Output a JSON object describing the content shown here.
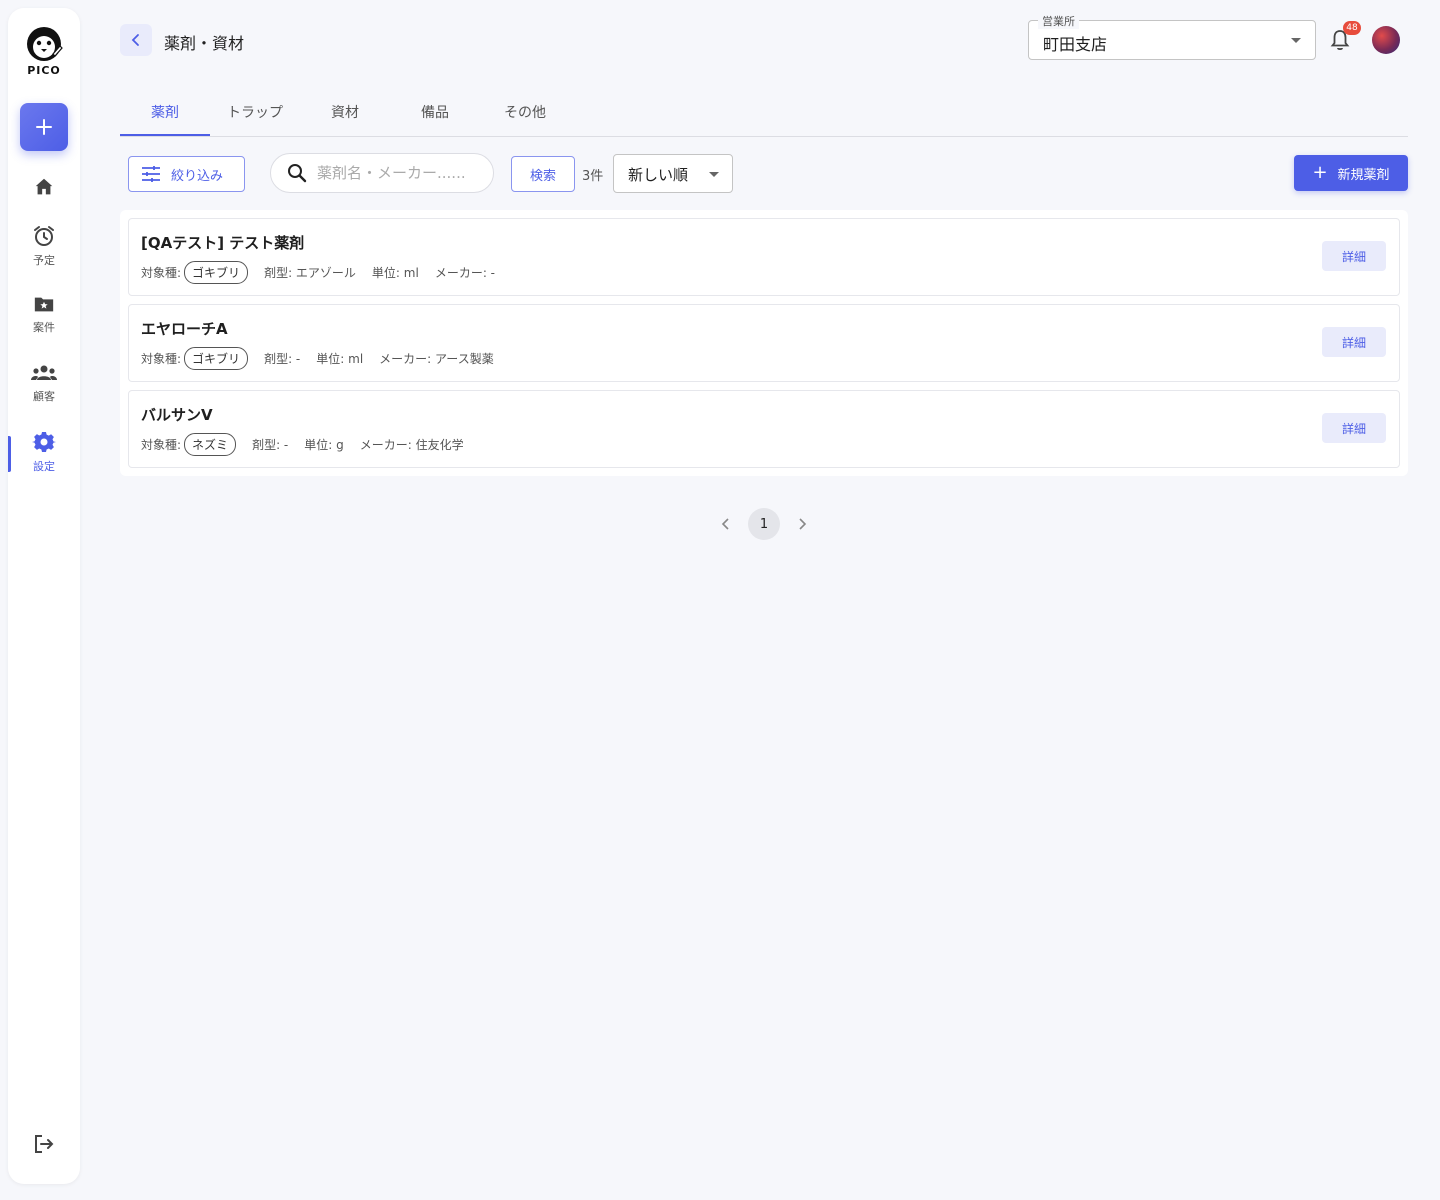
{
  "app": {
    "logo_text": "PICO"
  },
  "sidebar": {
    "items": [
      {
        "label": "",
        "icon": "home-icon"
      },
      {
        "label": "予定",
        "icon": "alarm-clock-icon"
      },
      {
        "label": "案件",
        "icon": "folder-star-icon"
      },
      {
        "label": "顧客",
        "icon": "people-icon"
      },
      {
        "label": "設定",
        "icon": "gear-icon",
        "active": true
      }
    ],
    "accent_color": "#4d5ee6"
  },
  "header": {
    "title": "薬剤・資材",
    "branch_label": "営業所",
    "branch_value": "町田支店",
    "notification_count": "48"
  },
  "tabs": [
    {
      "label": "薬剤",
      "active": true
    },
    {
      "label": "トラップ"
    },
    {
      "label": "資材"
    },
    {
      "label": "備品"
    },
    {
      "label": "その他"
    }
  ],
  "toolbar": {
    "filter_label": "絞り込み",
    "search_placeholder": "薬剤名・メーカー......",
    "search_label": "検索",
    "count": "3件",
    "sort_value": "新しい順",
    "new_label": "新規薬剤"
  },
  "list": {
    "target_label": "対象種:",
    "detail_label": "詳細",
    "items": [
      {
        "name": "[QAテスト] テスト薬剤",
        "target": "ゴキブリ",
        "form": "剤型: エアゾール",
        "unit": "単位: ml",
        "maker": "メーカー: -"
      },
      {
        "name": "エヤローチA",
        "target": "ゴキブリ",
        "form": "剤型: -",
        "unit": "単位: ml",
        "maker": "メーカー: アース製薬"
      },
      {
        "name": "バルサンV",
        "target": "ネズミ",
        "form": "剤型: -",
        "unit": "単位: g",
        "maker": "メーカー: 住友化学"
      }
    ]
  },
  "pagination": {
    "current": "1"
  }
}
